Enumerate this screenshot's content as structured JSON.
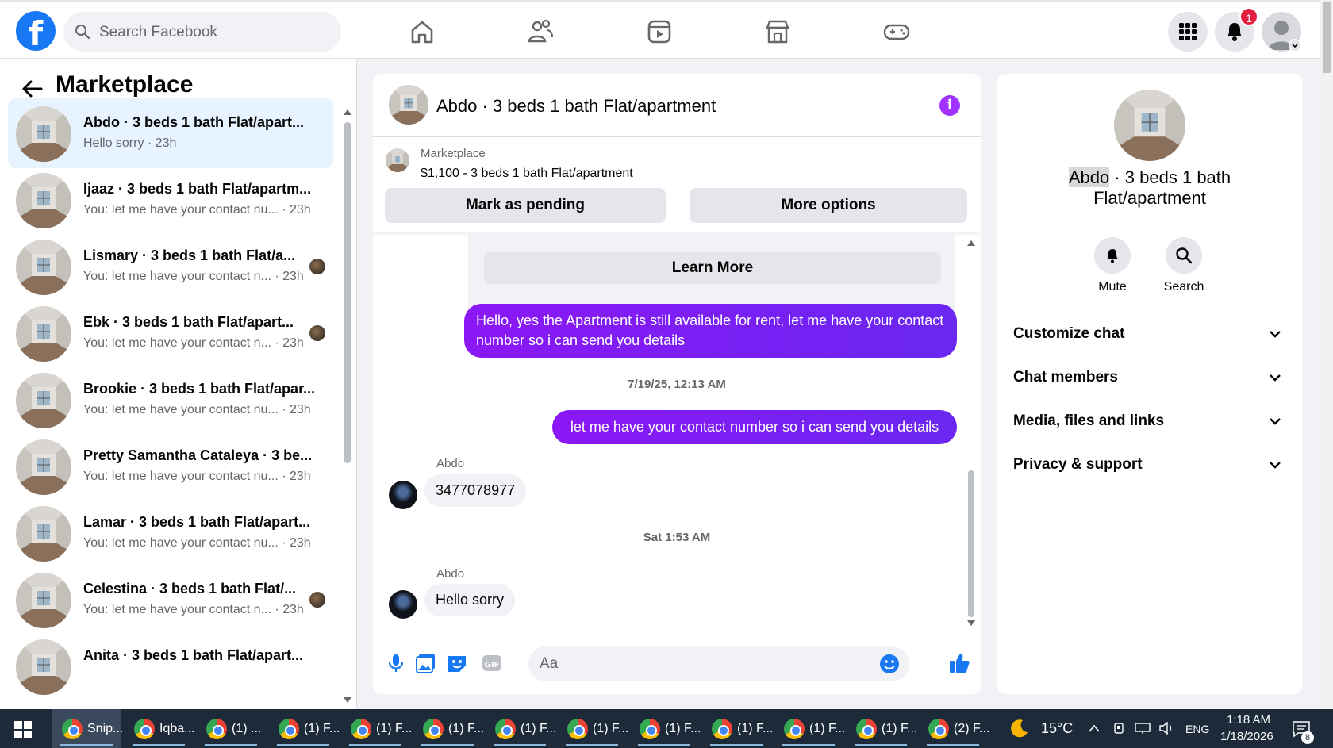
{
  "topnav": {
    "logo": "f",
    "search_placeholder": "Search Facebook",
    "notification_count": "1",
    "icons": [
      "home-icon",
      "friends-icon",
      "video-icon",
      "marketplace-icon",
      "gaming-icon",
      "menu-grid-icon",
      "bell-icon",
      "account-icon"
    ]
  },
  "sidebar": {
    "title": "Marketplace",
    "conversations": [
      {
        "name": "Abdo · 3 beds 1 bath Flat/apart...",
        "preview": "Hello sorry · 23h",
        "active": true
      },
      {
        "name": "Ijaaz · 3 beds 1 bath Flat/apartm...",
        "preview": "You: let me have your contact nu... · 23h"
      },
      {
        "name": "Lismary · 3 beds 1 bath Flat/a...",
        "preview": "You: let me have your contact n... · 23h"
      },
      {
        "name": "Ebk · 3 beds 1 bath Flat/apart...",
        "preview": "You: let me have your contact n... · 23h"
      },
      {
        "name": "Brookie · 3 beds 1 bath Flat/apar...",
        "preview": "You: let me have your contact nu... · 23h"
      },
      {
        "name": "Pretty Samantha Cataleya · 3 be...",
        "preview": "You: let me have your contact nu... · 23h"
      },
      {
        "name": "Lamar · 3 beds 1 bath Flat/apart...",
        "preview": "You: let me have your contact nu... · 23h"
      },
      {
        "name": "Celestina · 3 beds 1 bath Flat/...",
        "preview": "You: let me have your contact n... · 23h"
      },
      {
        "name": "Anita · 3 beds 1 bath Flat/apart...",
        "preview": ""
      }
    ]
  },
  "chat": {
    "title": "Abdo · 3 beds 1 bath Flat/apartment",
    "marketplace_label": "Marketplace",
    "listing": "$1,100 - 3 beds 1 bath Flat/apartment",
    "mark_pending": "Mark as pending",
    "more_options": "More options",
    "learn_more": "Learn More",
    "msg1": "Hello, yes the Apartment is still available for rent, let me have your contact number so i can send you details",
    "time1": "7/19/25, 12:13 AM",
    "msg2": "let me have your contact number so i can send you details",
    "sender": "Abdo",
    "msg3": "3477078977",
    "time2": "Sat 1:53 AM",
    "msg4": "Hello sorry",
    "composer_placeholder": "Aa"
  },
  "rpanel": {
    "name_highlight": "Abdo",
    "title_rest": " · 3 beds 1 bath Flat/apartment",
    "mute": "Mute",
    "search": "Search",
    "sections": [
      "Customize chat",
      "Chat members",
      "Media, files and links",
      "Privacy & support"
    ]
  },
  "taskbar": {
    "items": [
      "Snip...",
      "Iqba...",
      "(1) ...",
      "(1) F...",
      "(1) F...",
      "(1) F...",
      "(1) F...",
      "(1) F...",
      "(1) F...",
      "(1) F...",
      "(1) F...",
      "(1) F...",
      "(2) F..."
    ],
    "temperature": "15°C",
    "lang": "ENG",
    "time": "1:18 AM",
    "date": "1/18/2026",
    "notif_count": "8"
  },
  "colors": {
    "brand": "#1877f2",
    "accent": "#a033ff",
    "bubble_out": "#7b1ff3"
  }
}
